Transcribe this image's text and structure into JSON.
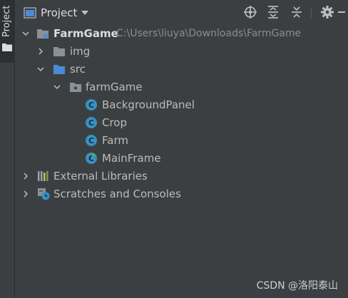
{
  "sidebar": {
    "tab_label": "Project"
  },
  "header": {
    "title": "Project"
  },
  "tree": {
    "root": {
      "label": "FarmGame",
      "path": "C:\\Users\\liuya\\Downloads\\FarmGame"
    },
    "img": "img",
    "src": "src",
    "package": "farmGame",
    "classes": [
      "BackgroundPanel",
      "Crop",
      "Farm",
      "MainFrame"
    ],
    "external": "External Libraries",
    "scratches": "Scratches and Consoles"
  },
  "watermark": "CSDN @洛阳泰山",
  "colors": {
    "background": "#3c3f41",
    "class_icon": "#3592c4",
    "folder": "#8a9097",
    "src_folder": "#4b8ad8"
  }
}
